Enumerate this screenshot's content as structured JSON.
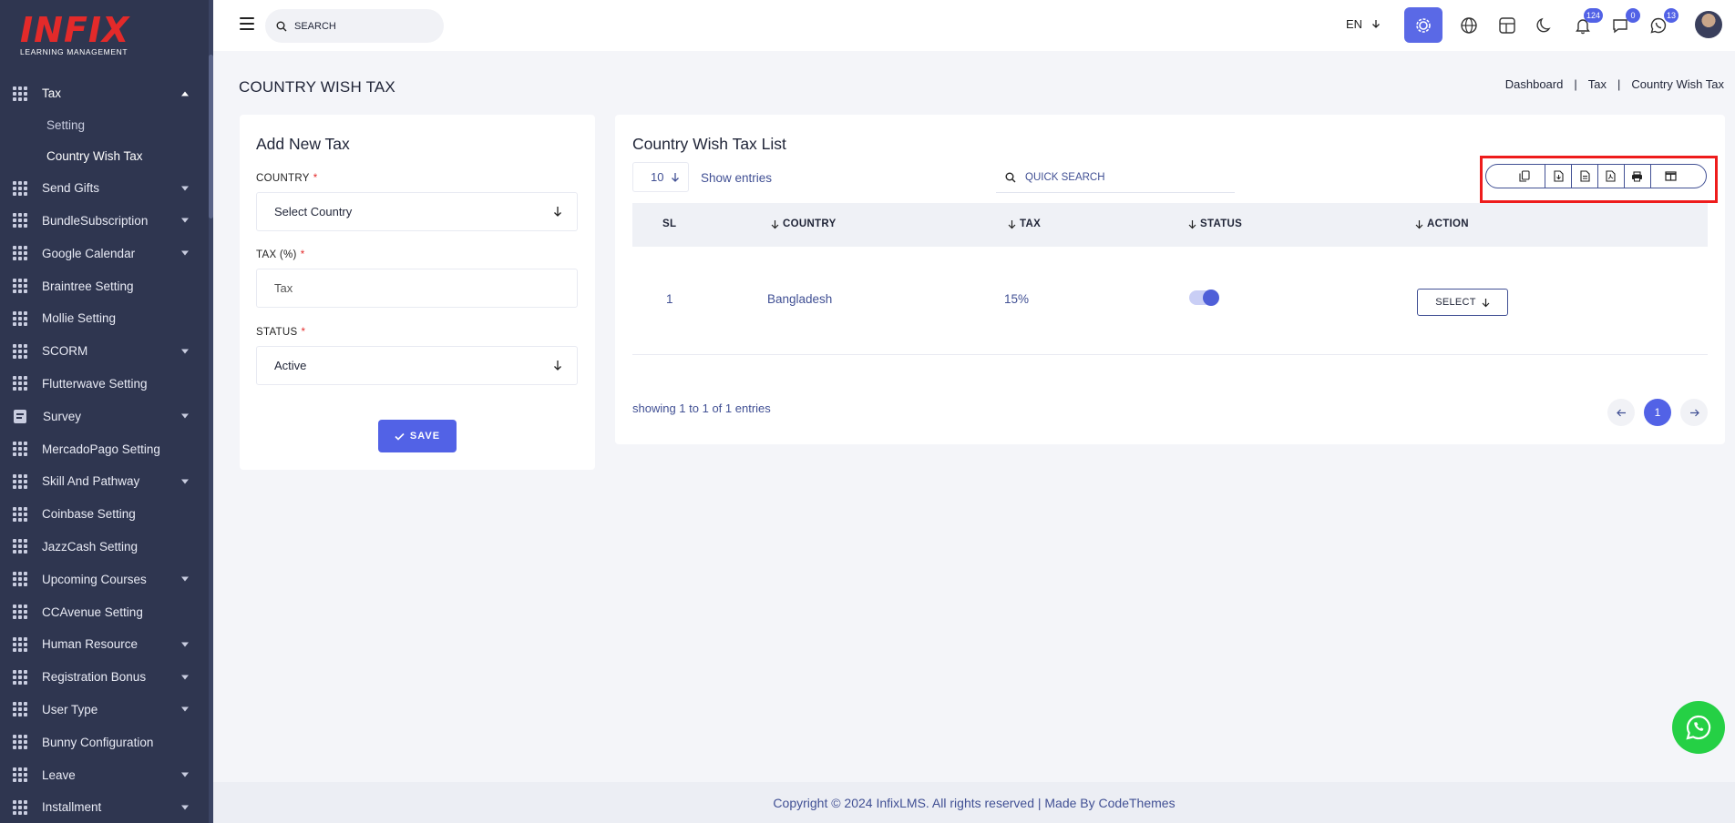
{
  "sidebar": {
    "logo_text": "INFIX",
    "logo_tagline": "LEARNING MANAGEMENT",
    "items": [
      {
        "label": "Tax",
        "icon": "grid-icon",
        "expanded": true,
        "sub": [
          {
            "label": "Setting"
          },
          {
            "label": "Country Wish Tax",
            "active": true
          }
        ]
      },
      {
        "label": "Send Gifts",
        "icon": "grid-icon",
        "caret": true
      },
      {
        "label": "BundleSubscription",
        "icon": "grid-icon",
        "caret": true
      },
      {
        "label": "Google Calendar",
        "icon": "grid-icon",
        "caret": true
      },
      {
        "label": "Braintree Setting",
        "icon": "grid-icon"
      },
      {
        "label": "Mollie Setting",
        "icon": "grid-icon"
      },
      {
        "label": "SCORM",
        "icon": "grid-icon",
        "caret": true
      },
      {
        "label": "Flutterwave Setting",
        "icon": "grid-icon"
      },
      {
        "label": "Survey",
        "icon": "document-icon",
        "caret": true
      },
      {
        "label": "MercadoPago Setting",
        "icon": "grid-icon"
      },
      {
        "label": "Skill And Pathway",
        "icon": "grid-icon",
        "caret": true
      },
      {
        "label": "Coinbase Setting",
        "icon": "grid-icon"
      },
      {
        "label": "JazzCash Setting",
        "icon": "grid-icon"
      },
      {
        "label": "Upcoming Courses",
        "icon": "grid-icon",
        "caret": true
      },
      {
        "label": "CCAvenue Setting",
        "icon": "grid-icon"
      },
      {
        "label": "Human Resource",
        "icon": "grid-icon",
        "caret": true
      },
      {
        "label": "Registration Bonus",
        "icon": "grid-icon",
        "caret": true
      },
      {
        "label": "User Type",
        "icon": "grid-icon",
        "caret": true
      },
      {
        "label": "Bunny Configuration",
        "icon": "grid-icon"
      },
      {
        "label": "Leave",
        "icon": "grid-icon",
        "caret": true
      },
      {
        "label": "Installment",
        "icon": "grid-icon",
        "caret": true
      }
    ]
  },
  "header": {
    "search_placeholder": "SEARCH",
    "language": "EN",
    "badges": {
      "notifications": "124",
      "messages": "0",
      "chat": "13"
    }
  },
  "page": {
    "title": "COUNTRY WISH TAX",
    "breadcrumb": [
      "Dashboard",
      "Tax",
      "Country Wish Tax"
    ]
  },
  "add_form": {
    "title": "Add New Tax",
    "country_label": "COUNTRY",
    "country_value": "Select Country",
    "tax_label": "TAX (%)",
    "tax_placeholder": "Tax",
    "status_label": "STATUS",
    "status_value": "Active",
    "required_mark": "*",
    "save_label": "SAVE"
  },
  "list": {
    "title": "Country Wish Tax List",
    "page_size": "10",
    "show_entries": "Show entries",
    "quick_search_placeholder": "QUICK SEARCH",
    "export_buttons": [
      "copy-icon",
      "csv-icon",
      "excel-icon",
      "pdf-icon",
      "print-icon",
      "columns-icon"
    ],
    "columns": [
      "SL",
      "COUNTRY",
      "TAX",
      "STATUS",
      "ACTION"
    ],
    "rows": [
      {
        "sl": "1",
        "country": "Bangladesh",
        "tax": "15%",
        "status_on": true,
        "action": "SELECT"
      }
    ],
    "showing": "showing 1 to 1 of 1 entries",
    "current_page": "1"
  },
  "footer": {
    "copyright": "Copyright © 2024 InfixLMS. All rights reserved | Made By CodeThemes"
  },
  "colors": {
    "accent": "#5262e6",
    "sidebar": "#2f3650",
    "highlight": "#ee1c1c",
    "whatsapp": "#25d045"
  }
}
